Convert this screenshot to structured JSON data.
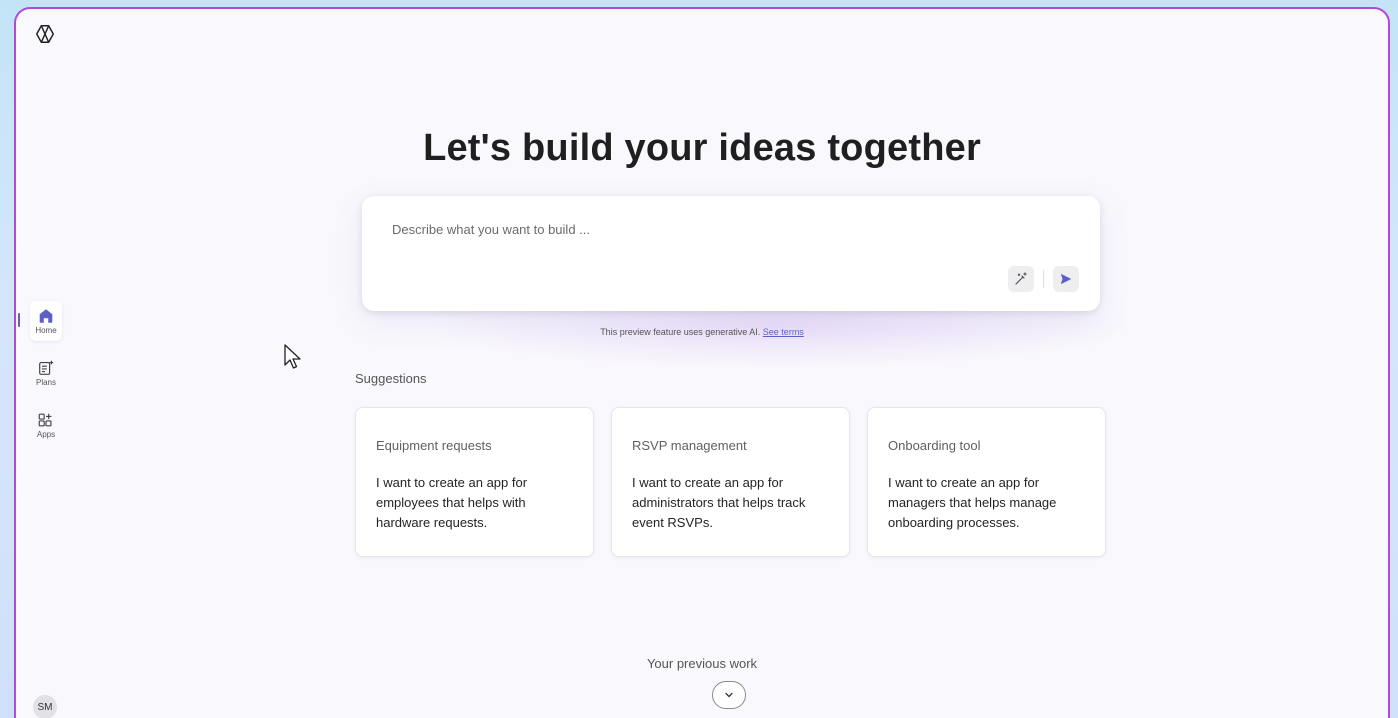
{
  "hero": {
    "title": "Let's build your ideas together"
  },
  "prompt": {
    "placeholder": "Describe what you want to build ...",
    "enhance_icon": "wand-icon",
    "send_icon": "send-icon"
  },
  "disclaimer": {
    "text": "This preview feature uses generative AI.",
    "link": "See terms"
  },
  "nav": {
    "items": [
      {
        "label": "Home",
        "icon": "home-icon",
        "active": true
      },
      {
        "label": "Plans",
        "icon": "plans-icon",
        "active": false
      },
      {
        "label": "Apps",
        "icon": "apps-icon",
        "active": false
      }
    ]
  },
  "suggestions": {
    "label": "Suggestions",
    "cards": [
      {
        "title": "Equipment requests",
        "description": "I want to create an app for employees that helps with hardware requests."
      },
      {
        "title": "RSVP management",
        "description": "I want to create an app for administrators that helps track event RSVPs."
      },
      {
        "title": "Onboarding tool",
        "description": "I want to create an app for managers that helps manage onboarding processes."
      }
    ]
  },
  "previous_work": {
    "label": "Your previous work"
  },
  "user": {
    "initials": "SM"
  },
  "colors": {
    "accent": "#5b5fc7",
    "frame_border": "#b24ad6"
  }
}
